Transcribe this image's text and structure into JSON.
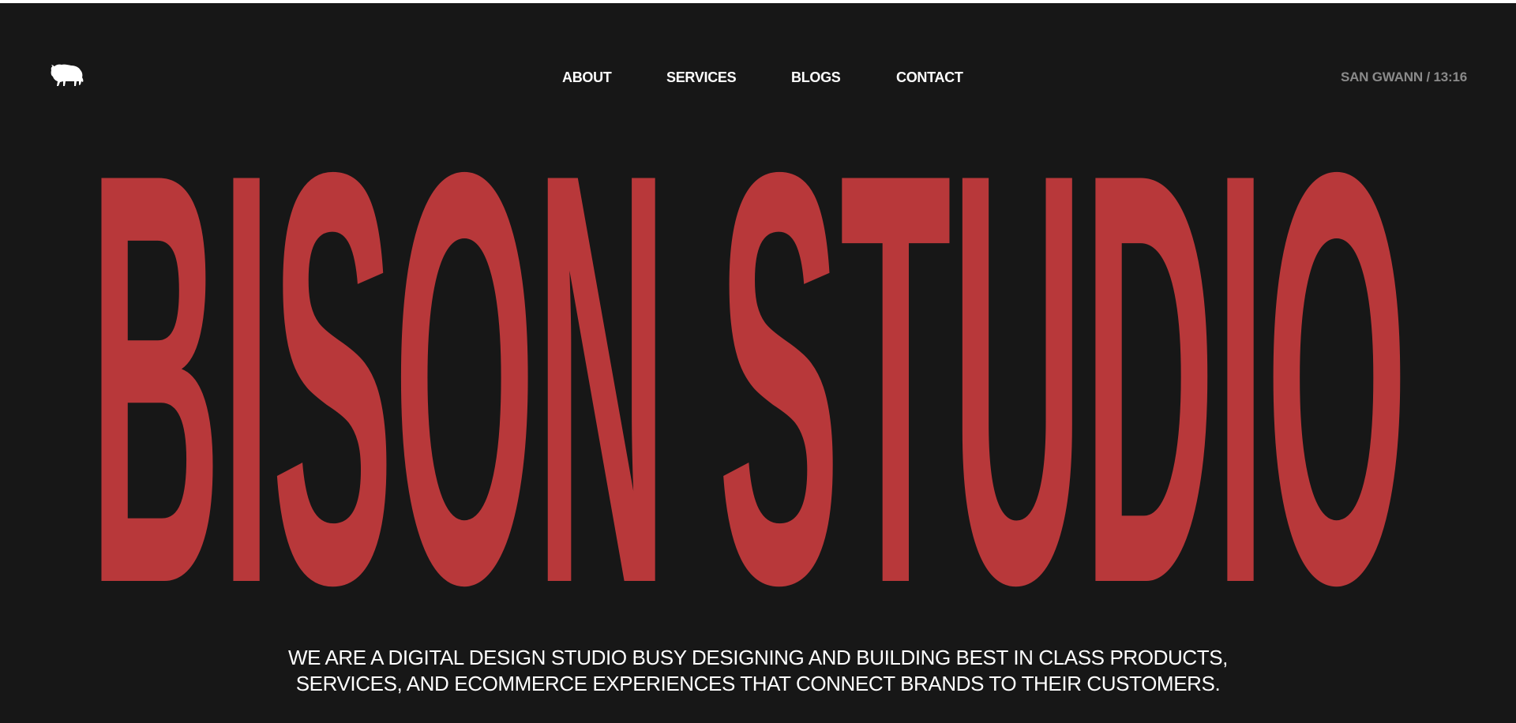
{
  "header": {
    "logo_icon": "bison-icon",
    "nav": [
      {
        "label": "ABOUT"
      },
      {
        "label": "SERVICES"
      },
      {
        "label": "BLOGS"
      },
      {
        "label": "CONTACT"
      }
    ],
    "location_time": "SAN GWANN / 13:16"
  },
  "hero": {
    "title": "BISON STUDIO",
    "title_color": "#b8383a",
    "tagline_line1": "WE ARE A DIGITAL DESIGN STUDIO BUSY DESIGNING AND BUILDING BEST IN CLASS PRODUCTS,",
    "tagline_line2": "SERVICES, AND ECOMMERCE EXPERIENCES THAT CONNECT BRANDS TO THEIR CUSTOMERS."
  },
  "colors": {
    "background": "#171717",
    "text": "#ffffff",
    "muted": "#8a8a8a",
    "accent": "#b8383a"
  }
}
